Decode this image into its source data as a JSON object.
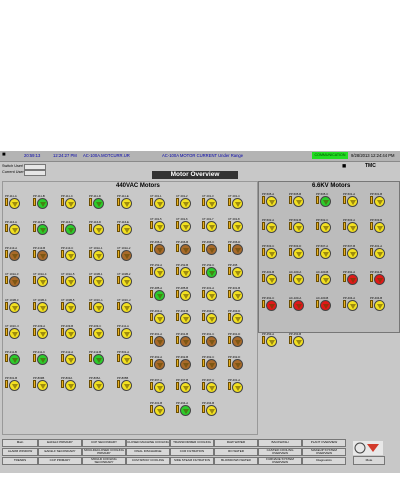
{
  "alarm_bar": {
    "time": "20:59:13",
    "alarm_time": "12:24:27 PM",
    "alarm_tag": "AC-100A.MOTCURR.UR",
    "alarm_message": "AC-100A MOTOR CURRENT  Under Range",
    "status": "COMMUNICATION",
    "datetime": "9/28/2013 12:24:44 PM"
  },
  "users": {
    "switch_label": "Switch User!",
    "current_label": "Current User:"
  },
  "title": "Motor Overview",
  "panels": {
    "left_title": "440VAC Motors",
    "right_title": "6.6KV Motors"
  },
  "motors_440": [
    {
      "label": "PP-111-A",
      "state": "off"
    },
    {
      "label": "PP-111-B",
      "state": "on"
    },
    {
      "label": "PP-111-C",
      "state": "off"
    },
    {
      "label": "PP-111-D",
      "state": "on"
    },
    {
      "label": "PP-111-E",
      "state": "off"
    },
    {
      "label": "PP-116-A",
      "state": "off"
    },
    {
      "label": "PP-116-B",
      "state": "on"
    },
    {
      "label": "PP-116-C",
      "state": "on"
    },
    {
      "label": "PP-116-D",
      "state": "off"
    },
    {
      "label": "PP-116-E",
      "state": "off"
    },
    {
      "label": "PP-213-A",
      "state": "trip"
    },
    {
      "label": "PP-213-B",
      "state": "trip"
    },
    {
      "label": "PP-213-C",
      "state": "off"
    },
    {
      "label": "CT 101A-1",
      "state": "off"
    },
    {
      "label": "CT 101A-2",
      "state": "trip"
    },
    {
      "label": "CT 101A-3",
      "state": "trip"
    },
    {
      "label": "CT 101A-4",
      "state": "off"
    },
    {
      "label": "CT 101A-5",
      "state": "off"
    },
    {
      "label": "CT 101B-1",
      "state": "off"
    },
    {
      "label": "CT 101B-2",
      "state": "off"
    },
    {
      "label": "CT 101B-3",
      "state": "off"
    },
    {
      "label": "CT 101B-4",
      "state": "off"
    },
    {
      "label": "CT 101B-5",
      "state": "off"
    },
    {
      "label": "CT 101C-1",
      "state": "off"
    },
    {
      "label": "CT 101C-2",
      "state": "off"
    },
    {
      "label": "CT 101C-3",
      "state": "off"
    },
    {
      "label": "PP-209-A",
      "state": "off"
    },
    {
      "label": "PP-209-B",
      "state": "off"
    },
    {
      "label": "PP-209-C",
      "state": "off"
    },
    {
      "label": "PP-211-A",
      "state": "off"
    },
    {
      "label": "PP-211-B",
      "state": "on"
    },
    {
      "label": "PP-211-C",
      "state": "on"
    },
    {
      "label": "PP-212-A",
      "state": "off"
    },
    {
      "label": "PP-212-B",
      "state": "on"
    },
    {
      "label": "PP-501-A",
      "state": "off"
    },
    {
      "label": "PP-501-B",
      "state": "off"
    },
    {
      "label": "PP-803B",
      "state": "off"
    },
    {
      "label": "PP-803A",
      "state": "off"
    },
    {
      "label": "PP-805A",
      "state": "off"
    },
    {
      "label": "PP-805B",
      "state": "off"
    }
  ],
  "motors_mid": [
    {
      "label": "CT 201-1",
      "state": "off"
    },
    {
      "label": "CT 201-2",
      "state": "off"
    },
    {
      "label": "CT 201-3",
      "state": "off"
    },
    {
      "label": "CT 201-4",
      "state": "off"
    },
    {
      "label": "CT 201-5",
      "state": "off"
    },
    {
      "label": "CT 201-6",
      "state": "off"
    },
    {
      "label": "CT 201-7",
      "state": "off"
    },
    {
      "label": "CT 201-8",
      "state": "off"
    },
    {
      "label": "PP-466-A",
      "state": "trip"
    },
    {
      "label": "PP-466-B",
      "state": "trip"
    },
    {
      "label": "PP-466-C",
      "state": "trip"
    },
    {
      "label": "PP-466-D",
      "state": "trip"
    },
    {
      "label": "PP-152-A",
      "state": "off"
    },
    {
      "label": "PP-152-B",
      "state": "off"
    },
    {
      "label": "PP-152-C",
      "state": "on"
    },
    {
      "label": "PP-495",
      "state": "off"
    },
    {
      "label": "PP-485-A",
      "state": "on"
    },
    {
      "label": "PP-485-B",
      "state": "off"
    },
    {
      "label": "PP-301-A",
      "state": "off"
    },
    {
      "label": "PP-301-B",
      "state": "off"
    },
    {
      "label": "PP-463-A",
      "state": "off"
    },
    {
      "label": "PP-463-B",
      "state": "off"
    },
    {
      "label": "PP-463-C",
      "state": "off"
    },
    {
      "label": "PP-463-D",
      "state": "off"
    },
    {
      "label": "PP-361-A",
      "state": "trip"
    },
    {
      "label": "PP-361-B",
      "state": "trip"
    },
    {
      "label": "PP-361-C",
      "state": "trip"
    },
    {
      "label": "PP-361-D",
      "state": "trip"
    },
    {
      "label": "PP-362-A",
      "state": "trip"
    },
    {
      "label": "PP-362-B",
      "state": "trip"
    },
    {
      "label": "PP-362-C",
      "state": "trip"
    },
    {
      "label": "PP-362-D",
      "state": "trip"
    },
    {
      "label": "PP-367-A",
      "state": "off"
    },
    {
      "label": "PP-367-B",
      "state": "off"
    },
    {
      "label": "PP-367-C",
      "state": "off"
    },
    {
      "label": "PP-401-A",
      "state": "off"
    },
    {
      "label": "PP-401-B",
      "state": "off"
    },
    {
      "label": "PP-264-A",
      "state": "on"
    },
    {
      "label": "PP-264-B",
      "state": "off"
    }
  ],
  "motors_6kv": [
    {
      "label": "PP-505-A",
      "state": "off"
    },
    {
      "label": "PP-505-B",
      "state": "off"
    },
    {
      "label": "PP-505-C",
      "state": "on"
    },
    {
      "label": "PP-501-A",
      "state": "off"
    },
    {
      "label": "PP-501-B",
      "state": "off"
    },
    {
      "label": "PP-502-A",
      "state": "off"
    },
    {
      "label": "PP-502-B",
      "state": "off"
    },
    {
      "label": "PP-502-C",
      "state": "off"
    },
    {
      "label": "PP-503-A",
      "state": "off"
    },
    {
      "label": "PP-503-B",
      "state": "off"
    },
    {
      "label": "PP-503-C",
      "state": "off"
    },
    {
      "label": "PP-503-D",
      "state": "off"
    },
    {
      "label": "PP-507-A",
      "state": "off"
    },
    {
      "label": "PP-507-B",
      "state": "off"
    },
    {
      "label": "PP-401-A",
      "state": "off"
    },
    {
      "label": "PP-401-B",
      "state": "off"
    },
    {
      "label": "AC-100-A",
      "state": "off"
    },
    {
      "label": "AC-100-B",
      "state": "off"
    },
    {
      "label": "PP-391-A",
      "state": "fault"
    },
    {
      "label": "PP-391-B",
      "state": "fault"
    },
    {
      "label": "PP-391-C",
      "state": "fault"
    },
    {
      "label": "AC-100-A",
      "state": "fault"
    },
    {
      "label": "AC-100-B",
      "state": "fault"
    },
    {
      "label": "PP-404-A",
      "state": "off"
    },
    {
      "label": "PP-404-B",
      "state": "off"
    },
    {
      "label": "PP-453-A",
      "state": "off"
    },
    {
      "label": "PP-453-B",
      "state": "off"
    }
  ],
  "nav": [
    [
      "Main",
      "EAF&LF PRIMARY",
      "CCP SECONDARY",
      "CLOSED MACHINE COOLING",
      "TRANSFORMER COOLING",
      "RAW WATER",
      "BACKWASH",
      "PLANT OVERVIEW"
    ],
    [
      "ALARM WINDOW",
      "EAF&LF SECONDARY",
      "MOULD&CLOSED COOLING PRIMARY",
      "FINAL DISCHARGE",
      "CCR FILTRATION",
      "RO WATER",
      "CASTER COOLING OVERVIEW",
      "MAKEUP SYSTEM OVERVIEW"
    ],
    [
      "TRENDS",
      "CCP PRIMARY",
      "MOULD COOLING SECONDARY",
      "CCM SPRAY COOLING",
      "SIDE STEAM FILTRATION",
      "BLOWDOWN WATER",
      "FURNACE SYSTEM OVERVIEW",
      "Diagnostics"
    ]
  ],
  "bottom_button": "Mute"
}
